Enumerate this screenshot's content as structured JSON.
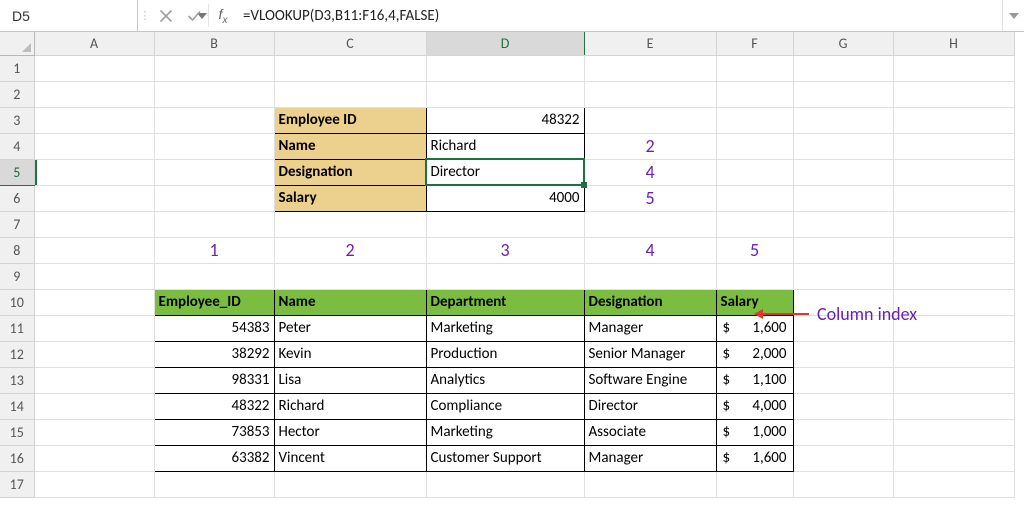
{
  "formula_bar": {
    "cell_ref": "D5",
    "formula": "=VLOOKUP(D3,B11:F16,4,FALSE)"
  },
  "columns": [
    "A",
    "B",
    "C",
    "D",
    "E",
    "F",
    "G",
    "H"
  ],
  "rows": [
    "1",
    "2",
    "3",
    "4",
    "5",
    "6",
    "7",
    "8",
    "9",
    "10",
    "11",
    "12",
    "13",
    "14",
    "15",
    "16",
    "17"
  ],
  "lookup_card": {
    "fields": [
      {
        "label": "Employee ID",
        "value": "48322",
        "val_align": "right",
        "annot": null
      },
      {
        "label": "Name",
        "value": "Richard",
        "val_align": "left",
        "annot": "2"
      },
      {
        "label": "Designation",
        "value": "Director",
        "val_align": "left",
        "annot": "4"
      },
      {
        "label": "Salary",
        "value": "4000",
        "val_align": "right",
        "annot": "5"
      }
    ]
  },
  "col_index_labels": [
    "1",
    "2",
    "3",
    "4",
    "5"
  ],
  "col_index_caption": "Column index",
  "table": {
    "headers": [
      "Employee_ID",
      "Name",
      "Department",
      "Designation",
      "Salary"
    ],
    "rows": [
      {
        "id": "54383",
        "name": "Peter",
        "dept": "Marketing",
        "desig": "Manager",
        "salary": "1,600"
      },
      {
        "id": "38292",
        "name": "Kevin",
        "dept": "Production",
        "desig": "Senior Manager",
        "salary": "2,000"
      },
      {
        "id": "98331",
        "name": "Lisa",
        "dept": "Analytics",
        "desig": "Software Engine",
        "salary": "1,100"
      },
      {
        "id": "48322",
        "name": "Richard",
        "dept": "Compliance",
        "desig": "Director",
        "salary": "4,000"
      },
      {
        "id": "73853",
        "name": "Hector",
        "dept": "Marketing",
        "desig": "Associate",
        "salary": "1,000"
      },
      {
        "id": "63382",
        "name": "Vincent",
        "dept": "Customer Support",
        "desig": "Manager",
        "salary": "1,600"
      }
    ],
    "currency": "$"
  }
}
